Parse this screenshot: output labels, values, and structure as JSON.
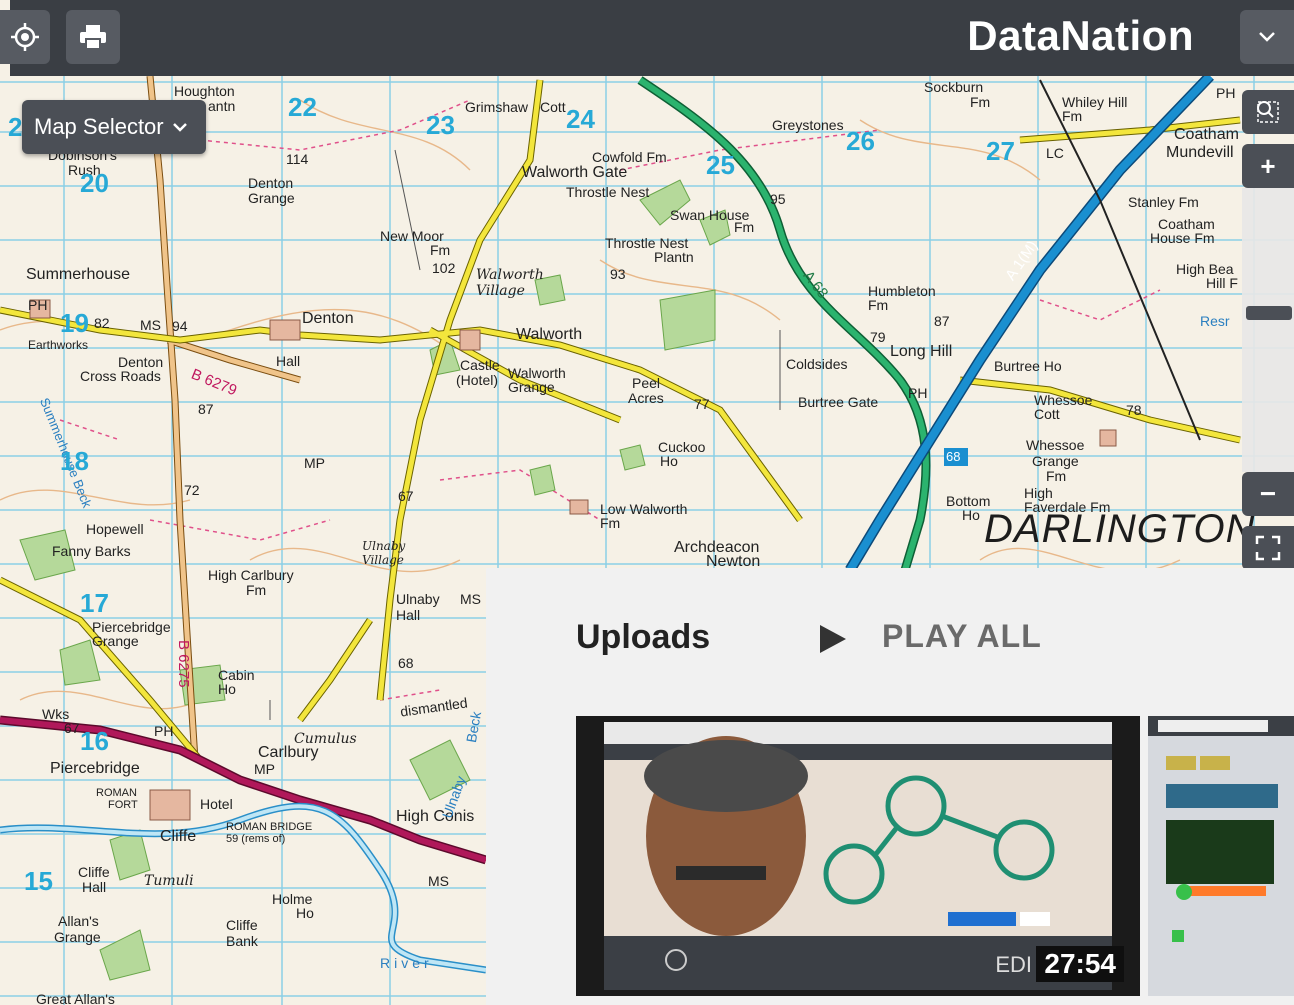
{
  "app": {
    "brand": "DataNation"
  },
  "toolbar": {
    "locate_icon": "crosshair-locate-icon",
    "print_icon": "printer-icon",
    "dropdown_icon": "chevron-down-icon"
  },
  "map_selector": {
    "label": "Map Selector"
  },
  "map_controls": {
    "area_zoom_icon": "zoom-area-icon",
    "zoom_in_label": "+",
    "zoom_out_label": "−",
    "fullscreen_icon": "fullscreen-icon",
    "zoom_level_fraction": 0.45
  },
  "map_labels": {
    "houghton": "Houghton",
    "plantn1": "antn",
    "grimshaw": "Grimshaw",
    "cott": "Cott",
    "cowfold": "Cowfold Fm",
    "walworth_gate": "Walworth Gate",
    "throstle_nest": "Throstle Nest",
    "swan_house": "Swan House",
    "fm": "Fm",
    "throstle_nest_plantn": "Throstle Nest",
    "plantn": "Plantn",
    "greystones": "Greystones",
    "sockburn": "Sockburn",
    "sockburn_fm": "Fm",
    "whiley_hill": "Whiley Hill",
    "whiley_fm": "Fm",
    "ph_top": "PH",
    "coatham": "Coatham",
    "mundevill": "Mundevill",
    "stanley_fm": "Stanley Fm",
    "coatham2": "Coatham",
    "house_fm": "House Fm",
    "high_bea": "High Bea",
    "hill_f": "Hill F",
    "resr": "Resr",
    "lc": "LC",
    "dobinsons": "Dobinson's",
    "rush": "Rush",
    "denton_grange": "Denton",
    "grange": "Grange",
    "n114": "114",
    "new_moor": "New Moor",
    "fm2": "Fm",
    "n102": "102",
    "walworth_village_a": "Walworth",
    "walworth_village_b": "Village",
    "n93": "93",
    "n95": "95",
    "a68": "A 68",
    "a1m": "A 1(M)",
    "humbleton": "Humbleton",
    "fm3": "Fm",
    "n79": "79",
    "n87": "87",
    "long_hill": "Long Hill",
    "burtree_ho": "Burtree Ho",
    "summerhouse": "Summerhouse",
    "ph_left": "PH",
    "n82": "82",
    "ms1": "MS",
    "n94": "94",
    "denton": "Denton",
    "earthworks": "Earthworks",
    "hall": "Hall",
    "denton_cross": "Denton",
    "cross_roads": "Cross Roads",
    "b6279": "B 6279",
    "n87b": "87",
    "walworth": "Walworth",
    "castle": "Castle",
    "hotel": "(Hotel)",
    "walworth_grange": "Walworth",
    "grange2": "Grange",
    "peel": "Peel",
    "acres": "Acres",
    "n77": "77",
    "coldsides": "Coldsides",
    "burtree_gate": "Burtree Gate",
    "ph_mid": "PH",
    "whessoe_cott": "Whessoe",
    "cott2": "Cott",
    "n78": "78",
    "whessoe_grange": "Whessoe",
    "grange3": "Grange",
    "fm4": "Fm",
    "summerhouse_beck": "Summerhouse Beck",
    "mp1": "MP",
    "cuckoo": "Cuckoo",
    "ho": "Ho",
    "n68_badge": "68",
    "bottom_ho": "Bottom",
    "ho2": "Ho",
    "high_faverdale": "High",
    "faverdale_fm": "Faverdale Fm",
    "darlington": "DARLINGTON",
    "n72": "72",
    "n67": "67",
    "low_walworth": "Low Walworth",
    "fm5": "Fm",
    "archdeacon": "Archdeacon",
    "newton": "Newton",
    "hopewell": "Hopewell",
    "fanny_barks": "Fanny Barks",
    "high_carlbury": "High Carlbury",
    "fm6": "Fm",
    "ulnaby_village_a": "Ulnaby",
    "ulnaby_village_b": "Village",
    "ulnaby_hall": "Ulnaby",
    "hall2": "Hall",
    "ms2": "MS",
    "piercebridge_grange": "Piercebridge",
    "grange4": "Grange",
    "b6275": "B 6275",
    "cabin_ho": "Cabin",
    "ho3": "Ho",
    "n68": "68",
    "dismantled": "dismantled",
    "wks": "Wks",
    "n67b": "67",
    "ph_low": "PH",
    "cumulus": "Cumulus",
    "carlbury": "Carlbury",
    "mp2": "MP",
    "beck": "Beck",
    "piercebridge": "Piercebridge",
    "roman_fort": "ROMAN",
    "fort": "FORT",
    "hotel2": "Hotel",
    "roman_bridge": "ROMAN BRIDGE",
    "rems": "59  (rems of)",
    "high_conis": "High Conis",
    "cliffe": "Cliffe",
    "ms3": "MS",
    "cliffe_hall": "Cliffe",
    "hall3": "Hall",
    "tumuli": "Tumuli",
    "holme": "Holme",
    "ho4": "Ho",
    "allans_grange": "Allan's",
    "grange5": "Grange",
    "cliffe_bank": "Cliffe",
    "bank": "Bank",
    "river": "River",
    "great_allans": "Great Allan's",
    "ulnaby_beck": "Ulnaby"
  },
  "grid_numbers": {
    "g22": "22",
    "g23": "23",
    "g24": "24",
    "g25": "25",
    "g26": "26",
    "g27": "27",
    "g20": "20",
    "g19": "19",
    "g18": "18",
    "g17": "17",
    "g16": "16",
    "g15": "15",
    "g2": "2"
  },
  "uploads": {
    "title": "Uploads",
    "play_icon": "play-icon",
    "play_all": "PLAY ALL",
    "video1": {
      "duration": "27:54",
      "overlay_text": "EDI"
    }
  },
  "colors": {
    "toolbar_bg": "#3a3e44",
    "control_bg": "#4b4f56",
    "grid_blue": "#27a9d6",
    "motorway_blue": "#1a8fd0",
    "primary_green": "#1f9a5a",
    "b_road_yellow": "#f3e63c",
    "rail_magenta": "#b0185a"
  }
}
